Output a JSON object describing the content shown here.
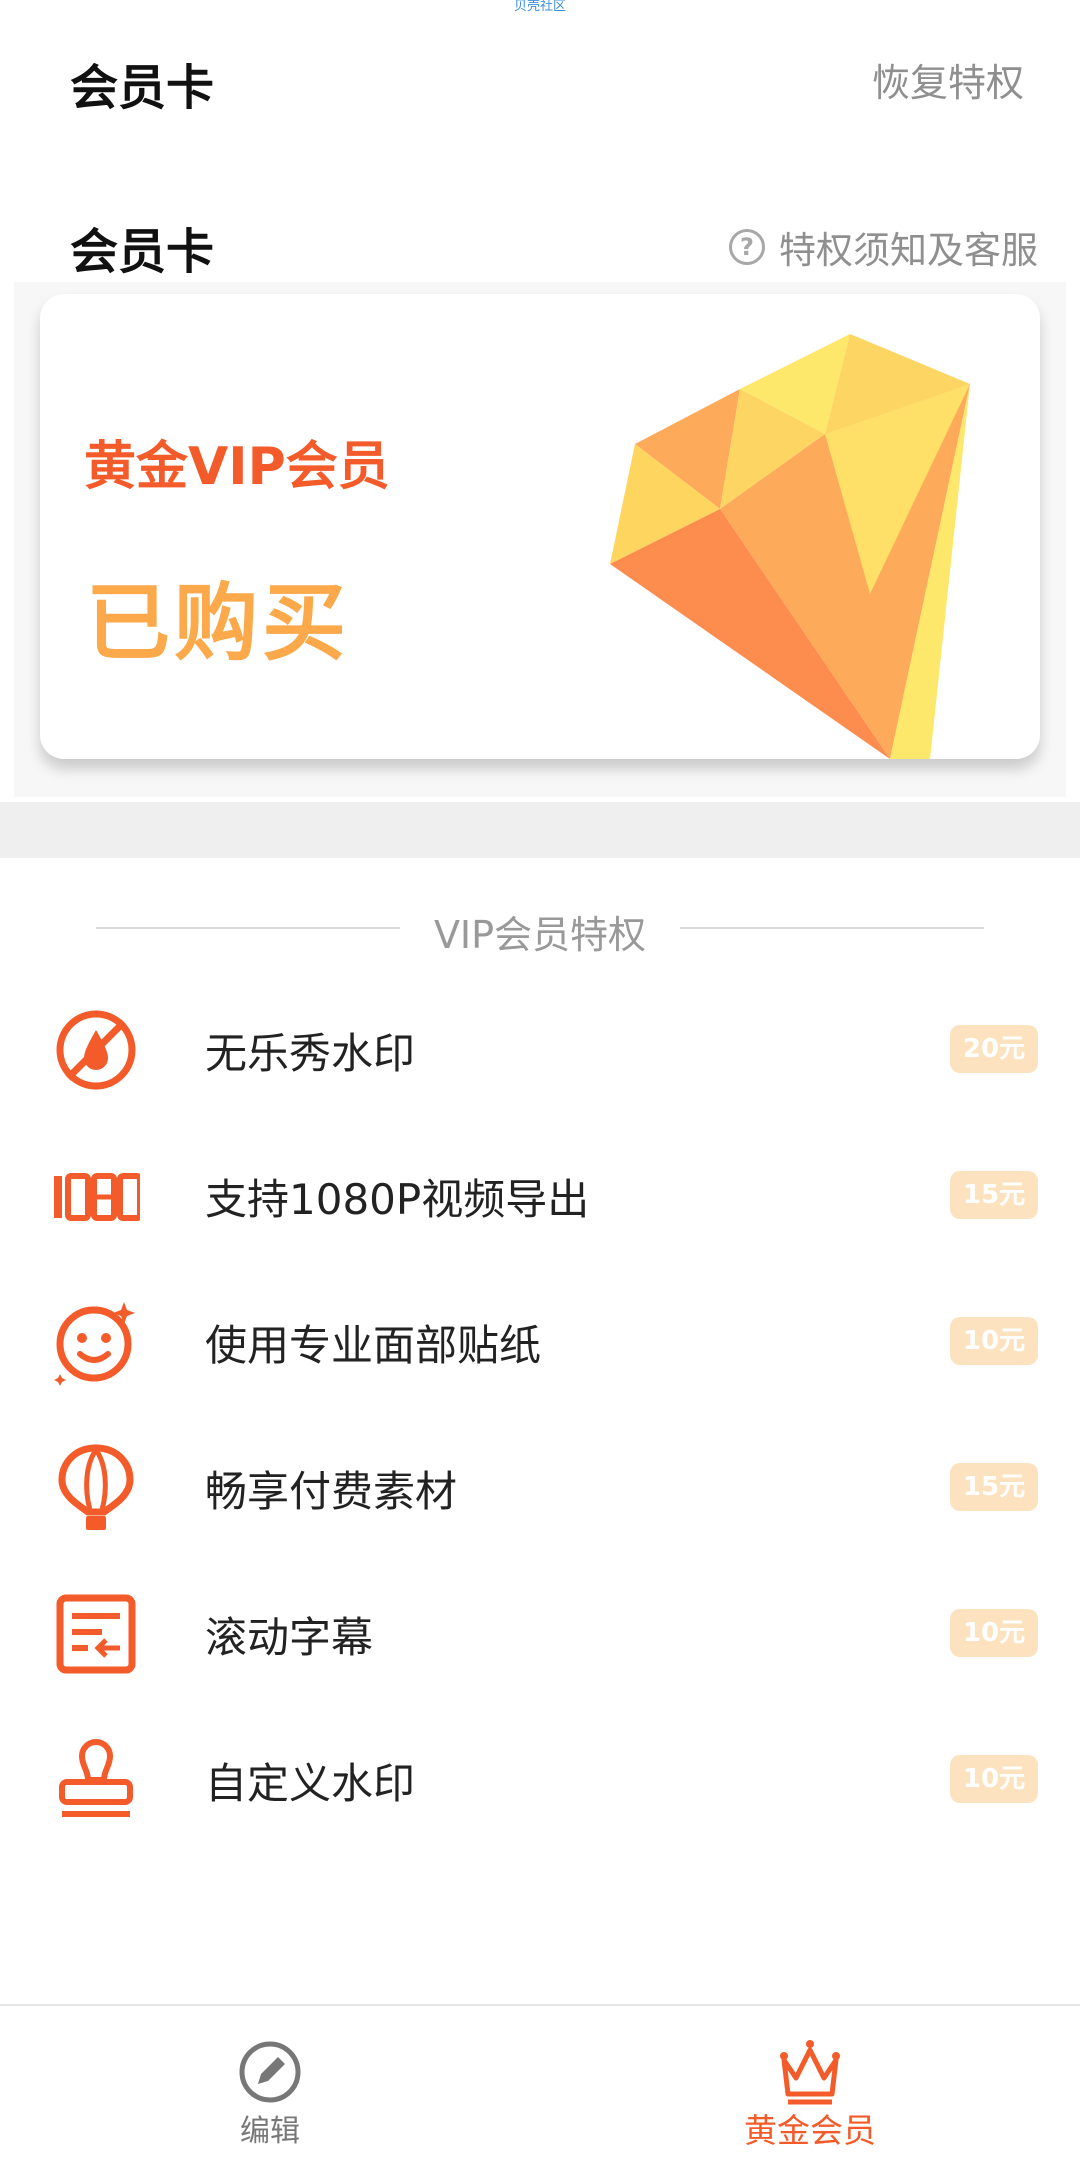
{
  "status_bar": {
    "watermark": "贝壳社区"
  },
  "header": {
    "title": "会员卡",
    "restore_label": "恢复特权"
  },
  "section": {
    "title": "会员卡",
    "help_label": "特权须知及客服",
    "help_icon": "question-circle-icon"
  },
  "card": {
    "tier": "黄金VIP会员",
    "status": "已购买",
    "graphic": "gold-diamond"
  },
  "perks": {
    "title": "VIP会员特权",
    "items": [
      {
        "icon": "no-watermark-icon",
        "label": "无乐秀水印",
        "price": "20元"
      },
      {
        "icon": "1080p-icon",
        "label": "支持1080P视频导出",
        "price": "15元"
      },
      {
        "icon": "face-sticker-icon",
        "label": "使用专业面部贴纸",
        "price": "10元"
      },
      {
        "icon": "balloon-icon",
        "label": "畅享付费素材",
        "price": "15元"
      },
      {
        "icon": "scrolling-subtitle-icon",
        "label": "滚动字幕",
        "price": "10元"
      },
      {
        "icon": "stamp-icon",
        "label": "自定义水印",
        "price": "10元"
      }
    ]
  },
  "bottom_nav": {
    "items": [
      {
        "icon": "edit-pencil-icon",
        "label": "编辑",
        "active": false
      },
      {
        "icon": "crown-icon",
        "label": "黄金会员",
        "active": true
      }
    ]
  },
  "colors": {
    "accent": "#f35c2a",
    "gold": "#fba94a",
    "price_badge": "#fde2bf",
    "muted": "#8f8f8f"
  }
}
